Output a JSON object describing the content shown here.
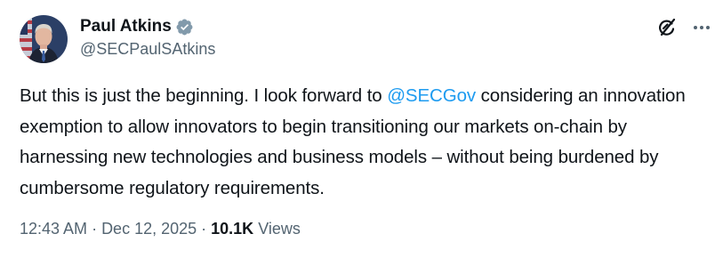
{
  "author": {
    "name": "Paul Atkins",
    "handle": "@SECPaulSAtkins",
    "verified_color": "#829aab"
  },
  "tweet": {
    "text_before_mention": "But this is just the beginning. I look forward to ",
    "mention": "@SECGov",
    "text_after_mention": " considering an innovation exemption to allow innovators to begin transitioning our markets on-chain by harnessing new technologies and business models – without being burdened by cumbersome regulatory requirements."
  },
  "meta": {
    "time": "12:43 AM",
    "separator": " · ",
    "date": "Dec 12, 2025",
    "separator2": " · ",
    "views_count": "10.1K",
    "views_label": " Views"
  },
  "colors": {
    "link": "#1d9bf0",
    "secondary_text": "#536471",
    "primary_text": "#0f1419"
  },
  "icons": {
    "grok": "grok-icon",
    "more": "more-icon"
  }
}
